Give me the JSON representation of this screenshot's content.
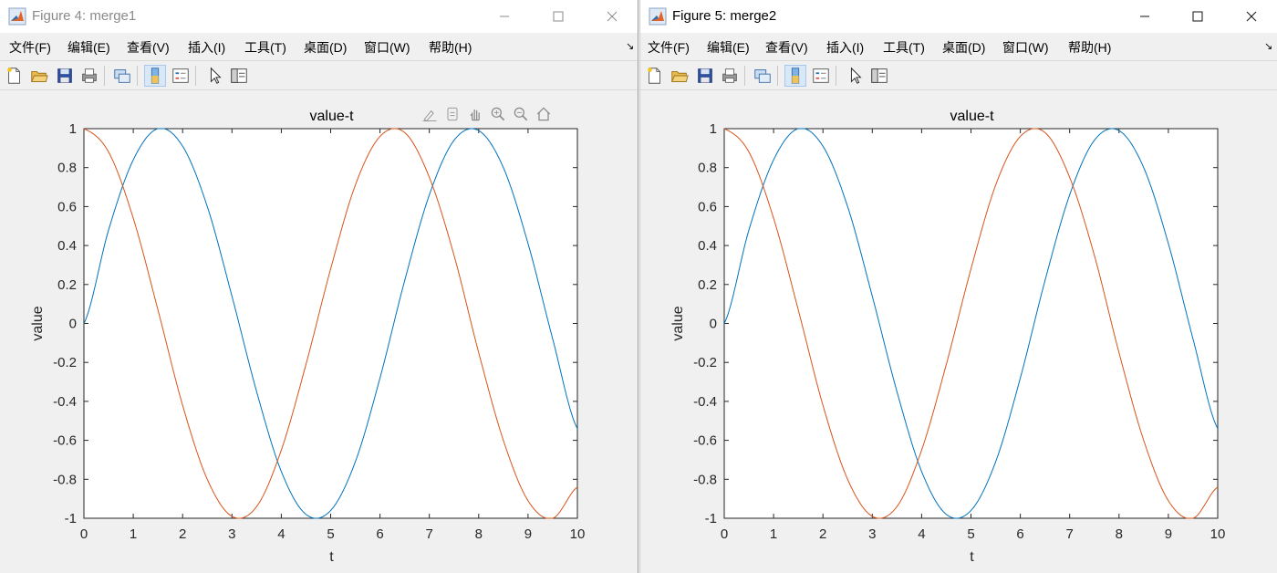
{
  "menus": [
    "文件(F)",
    "编辑(E)",
    "查看(V)",
    "插入(I)",
    "工具(T)",
    "桌面(D)",
    "窗口(W)",
    "帮助(H)"
  ],
  "toolbar_icons": [
    "new-file-icon",
    "open-folder-icon",
    "save-icon",
    "print-icon",
    "link-plot-icon",
    "colorbar-icon",
    "legend-icon",
    "pointer-icon",
    "property-inspector-icon"
  ],
  "axes_toolbar_icons": [
    "brush-icon",
    "data-tips-icon",
    "pan-icon",
    "zoom-in-icon",
    "zoom-out-icon",
    "home-icon"
  ],
  "colors": {
    "series1": "#0072BD",
    "series2": "#D95319",
    "accent": "#a9c7ea"
  },
  "figures": [
    {
      "title": "Figure 4: merge1",
      "focused": false,
      "chart_data": {
        "type": "line",
        "title": "value-t",
        "xlabel": "t",
        "ylabel": "value",
        "xlim": [
          0,
          10
        ],
        "ylim": [
          -1,
          1
        ],
        "xticks": [
          "0",
          "1",
          "2",
          "3",
          "4",
          "5",
          "6",
          "7",
          "8",
          "9",
          "10"
        ],
        "yticks": [
          "-1",
          "-0.8",
          "-0.6",
          "-0.4",
          "-0.2",
          "0",
          "0.2",
          "0.4",
          "0.6",
          "0.8",
          "1"
        ],
        "grid": false,
        "series": [
          {
            "color": "#0072BD",
            "x": [
              0,
              0.5,
              1,
              1.5,
              2,
              2.5,
              3,
              3.5,
              4,
              4.5,
              5,
              5.5,
              6,
              6.5,
              7,
              7.5,
              8,
              8.5,
              9,
              9.5,
              10
            ],
            "y": [
              0,
              0.48,
              0.84,
              1.0,
              0.91,
              0.6,
              0.14,
              -0.35,
              -0.76,
              -0.98,
              -0.96,
              -0.71,
              -0.28,
              0.22,
              0.66,
              0.94,
              0.99,
              0.8,
              0.41,
              -0.08,
              -0.54
            ]
          },
          {
            "color": "#D95319",
            "x": [
              0,
              0.5,
              1,
              1.5,
              2,
              2.5,
              3,
              3.5,
              4,
              4.5,
              5,
              5.5,
              6,
              6.5,
              7,
              7.5,
              8,
              8.5,
              9,
              9.5,
              10
            ],
            "y": [
              1,
              0.88,
              0.54,
              0.07,
              -0.42,
              -0.8,
              -0.99,
              -0.94,
              -0.65,
              -0.21,
              0.28,
              0.71,
              0.96,
              0.98,
              0.75,
              0.35,
              -0.15,
              -0.6,
              -0.91,
              -1.0,
              -0.84
            ]
          }
        ]
      }
    },
    {
      "title": "Figure 5: merge2",
      "focused": true,
      "chart_data": {
        "type": "line",
        "title": "value-t",
        "xlabel": "t",
        "ylabel": "value",
        "xlim": [
          0,
          10
        ],
        "ylim": [
          -1,
          1
        ],
        "xticks": [
          "0",
          "1",
          "2",
          "3",
          "4",
          "5",
          "6",
          "7",
          "8",
          "9",
          "10"
        ],
        "yticks": [
          "-1",
          "-0.8",
          "-0.6",
          "-0.4",
          "-0.2",
          "0",
          "0.2",
          "0.4",
          "0.6",
          "0.8",
          "1"
        ],
        "grid": false,
        "series": [
          {
            "color": "#0072BD",
            "x": [
              0,
              0.5,
              1,
              1.5,
              2,
              2.5,
              3,
              3.5,
              4,
              4.5,
              5,
              5.5,
              6,
              6.5,
              7,
              7.5,
              8,
              8.5,
              9,
              9.5,
              10
            ],
            "y": [
              0,
              0.48,
              0.84,
              1.0,
              0.91,
              0.6,
              0.14,
              -0.35,
              -0.76,
              -0.98,
              -0.96,
              -0.71,
              -0.28,
              0.22,
              0.66,
              0.94,
              0.99,
              0.8,
              0.41,
              -0.08,
              -0.54
            ]
          },
          {
            "color": "#D95319",
            "x": [
              0,
              0.5,
              1,
              1.5,
              2,
              2.5,
              3,
              3.5,
              4,
              4.5,
              5,
              5.5,
              6,
              6.5,
              7,
              7.5,
              8,
              8.5,
              9,
              9.5,
              10
            ],
            "y": [
              1,
              0.88,
              0.54,
              0.07,
              -0.42,
              -0.8,
              -0.99,
              -0.94,
              -0.65,
              -0.21,
              0.28,
              0.71,
              0.96,
              0.98,
              0.75,
              0.35,
              -0.15,
              -0.6,
              -0.91,
              -1.0,
              -0.84
            ]
          }
        ]
      }
    }
  ]
}
